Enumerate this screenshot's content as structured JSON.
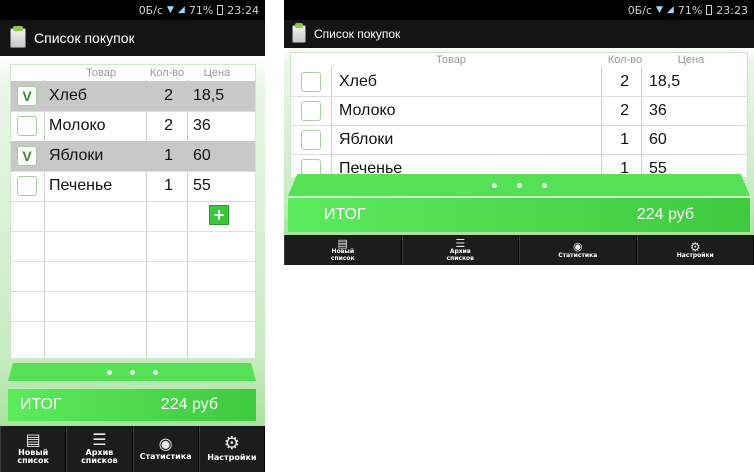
{
  "status": {
    "network": "0Б/с",
    "battery": "71%",
    "time": "23:24"
  },
  "status2": {
    "network": "0Б/с",
    "battery": "71%",
    "time": "23:23"
  },
  "title": "Список покупок",
  "columns": {
    "item": "Товар",
    "qty": "Кол-во",
    "price": "Цена"
  },
  "items": [
    {
      "name": "Хлеб",
      "qty": "2",
      "price": "18,5",
      "checked": true,
      "check_mark": "V"
    },
    {
      "name": "Молоко",
      "qty": "2",
      "price": "36",
      "checked": false,
      "check_mark": ""
    },
    {
      "name": "Яблоки",
      "qty": "1",
      "price": "60",
      "checked": true,
      "check_mark": "V"
    },
    {
      "name": "Печенье",
      "qty": "1",
      "price": "55",
      "checked": false,
      "check_mark": ""
    }
  ],
  "items_landscape": [
    {
      "name": "Хлеб",
      "qty": "2",
      "price": "18,5",
      "checked": false
    },
    {
      "name": "Молоко",
      "qty": "2",
      "price": "36",
      "checked": false
    },
    {
      "name": "Яблоки",
      "qty": "1",
      "price": "60",
      "checked": false
    },
    {
      "name": "Печенье",
      "qty": "1",
      "price": "55",
      "checked": false
    }
  ],
  "add_label": "+",
  "total": {
    "label": "ИТОГ",
    "value": "224 руб"
  },
  "toolbar": {
    "new_line1": "Новый",
    "new_line2": "список",
    "archive_line1": "Архив",
    "archive_line2": "списков",
    "stats": "Статистика",
    "settings": "Настройки"
  },
  "icons": {
    "new": "document-icon",
    "archive": "archive-stack-icon",
    "stats": "stats-person-icon",
    "settings": "gears-icon"
  },
  "colors": {
    "accent": "#3fc93f",
    "check": "#2e8b2e",
    "toolbar": "#1c1c1c"
  }
}
